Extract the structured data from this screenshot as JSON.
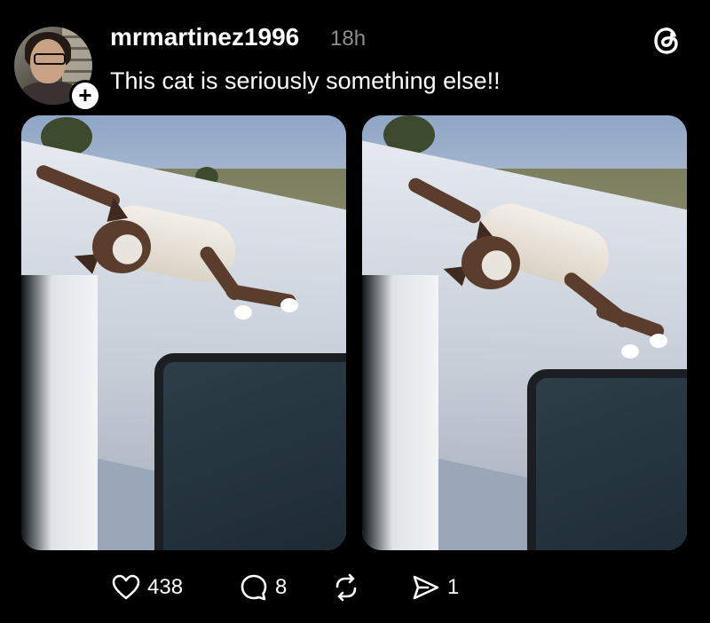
{
  "post": {
    "username": "mrmartinez1996",
    "timestamp": "18h",
    "text": "This cat is seriously something else!!",
    "follow_badge": "+"
  },
  "media": [
    {
      "name": "photo-1"
    },
    {
      "name": "photo-2"
    }
  ],
  "actions": {
    "likes": "438",
    "replies": "8",
    "reposts": "",
    "shares": "1"
  },
  "icons": {
    "app_logo": "threads-logo-icon",
    "like": "heart-icon",
    "reply": "comment-bubble-icon",
    "repost": "repost-icon",
    "share": "send-icon"
  },
  "colors": {
    "background": "#000000",
    "text": "#ffffff",
    "muted": "#8e8e8e"
  }
}
